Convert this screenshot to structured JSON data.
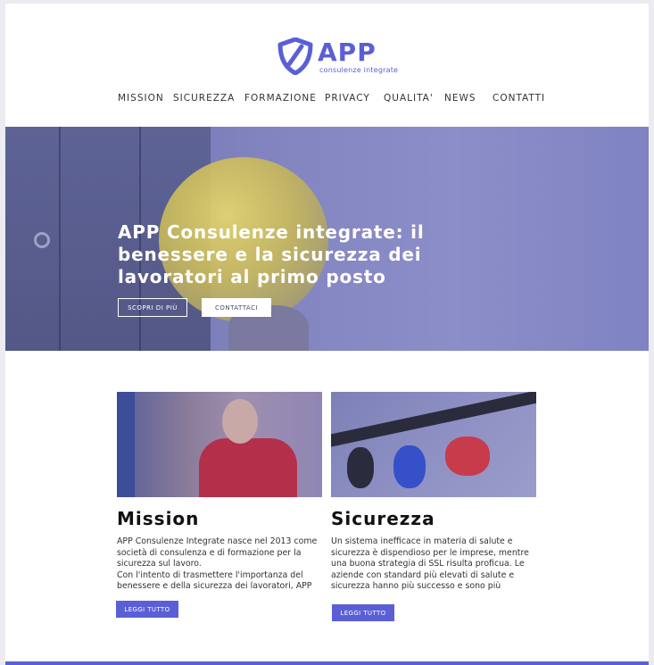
{
  "header": {
    "logo_text": "APP",
    "logo_tagline": "consulenze integrate"
  },
  "nav": {
    "items": [
      "MISSION",
      "SICUREZZA",
      "FORMAZIONE",
      "PRIVACY",
      "QUALITA'",
      "NEWS",
      "CONTATTI"
    ]
  },
  "hero": {
    "title": "APP Consulenze integrate: il benessere e la sicurezza dei lavoratori al primo posto",
    "primary_button": "SCOPRI DI PIÙ",
    "secondary_button": "CONTATTACI"
  },
  "cards": [
    {
      "title": "Mission",
      "text": "APP Consulenze Integrate nasce nel 2013 come società di consulenza e di formazione per la sicurezza sul lavoro.\nCon l'intento di trasmettere l'importanza del benessere e della sicurezza dei lavoratori, APP",
      "button": "LEGGI TUTTO"
    },
    {
      "title": "Sicurezza",
      "text": "Un sistema inefficace in materia di salute e sicurezza è dispendioso per le imprese, mentre una buona strategia di SSL risulta proficua. Le aziende con standard più elevati di salute e sicurezza hanno più successo e sono più",
      "button": "LEGGI TUTTO"
    }
  ],
  "colors": {
    "brand": "#5a5fd6",
    "hero_overlay": "#8286c2"
  }
}
